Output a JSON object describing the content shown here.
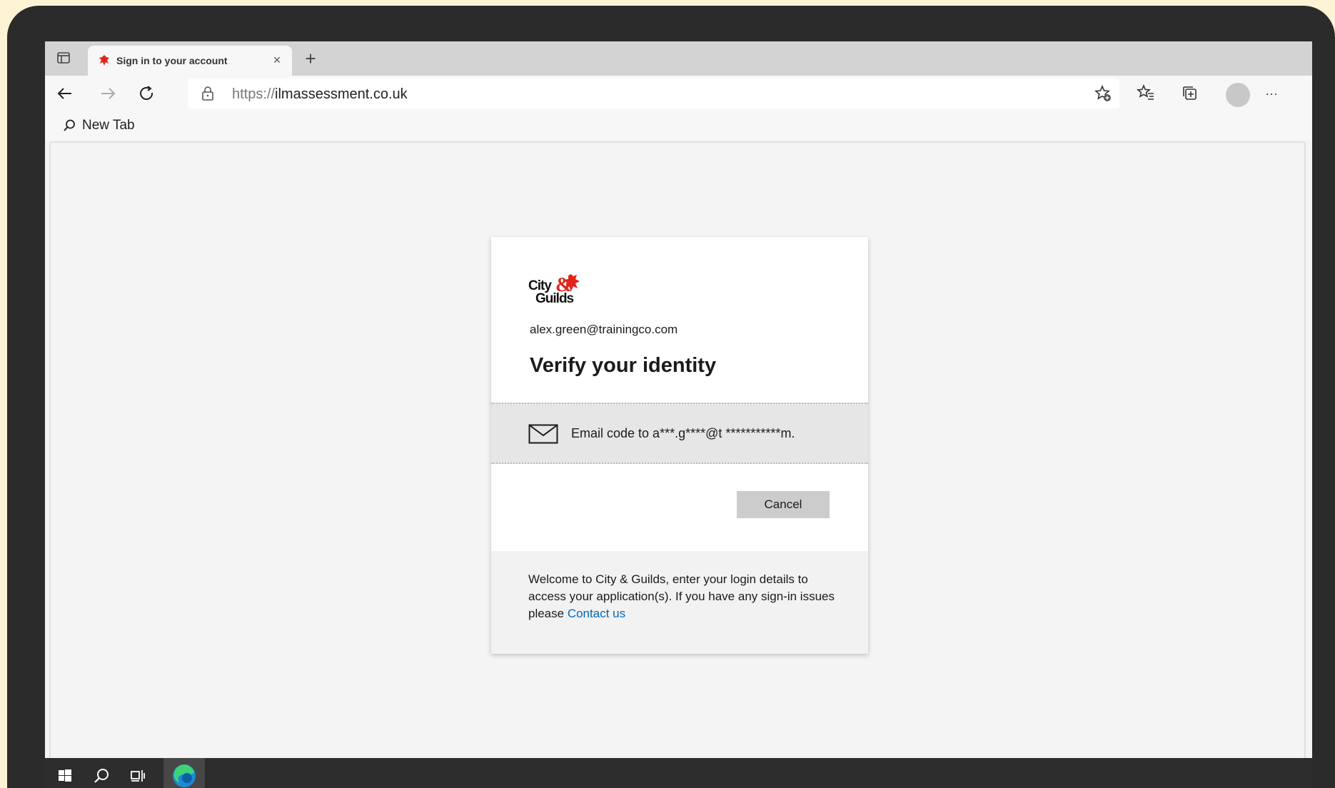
{
  "browser": {
    "tab_title": "Sign in to your account",
    "tab_close": "×",
    "new_tab": "+",
    "url_scheme": "https://",
    "url_host": "ilmassessment.co.uk",
    "more_menu": "···",
    "bookmark_label": "New Tab"
  },
  "signin": {
    "logo_text": "City & Guilds",
    "email": "alex.green@trainingco.com",
    "title": "Verify your identity",
    "option_label": "Email code to a***.g****@t ***********m.",
    "cancel_label": "Cancel",
    "footer_text": "Welcome to City & Guilds, enter your login details to access your application(s). If you have any sign-in issues please ",
    "footer_link": "Contact us"
  },
  "icons": {
    "tab_actions": "tab-actions-icon",
    "favicon": "city-guilds-lion-icon",
    "back": "back-arrow-icon",
    "forward": "forward-arrow-icon",
    "refresh": "refresh-icon",
    "lock": "lock-icon",
    "add_favorite": "star-plus-icon",
    "favorites": "favorites-icon",
    "collections": "collections-icon",
    "search": "search-icon",
    "mail": "envelope-icon",
    "windows": "windows-start-icon",
    "task_view": "task-view-icon",
    "edge": "edge-browser-icon"
  },
  "colors": {
    "brand_red": "#e2231a",
    "link_blue": "#0067b8",
    "background": "#fcf4d5"
  }
}
